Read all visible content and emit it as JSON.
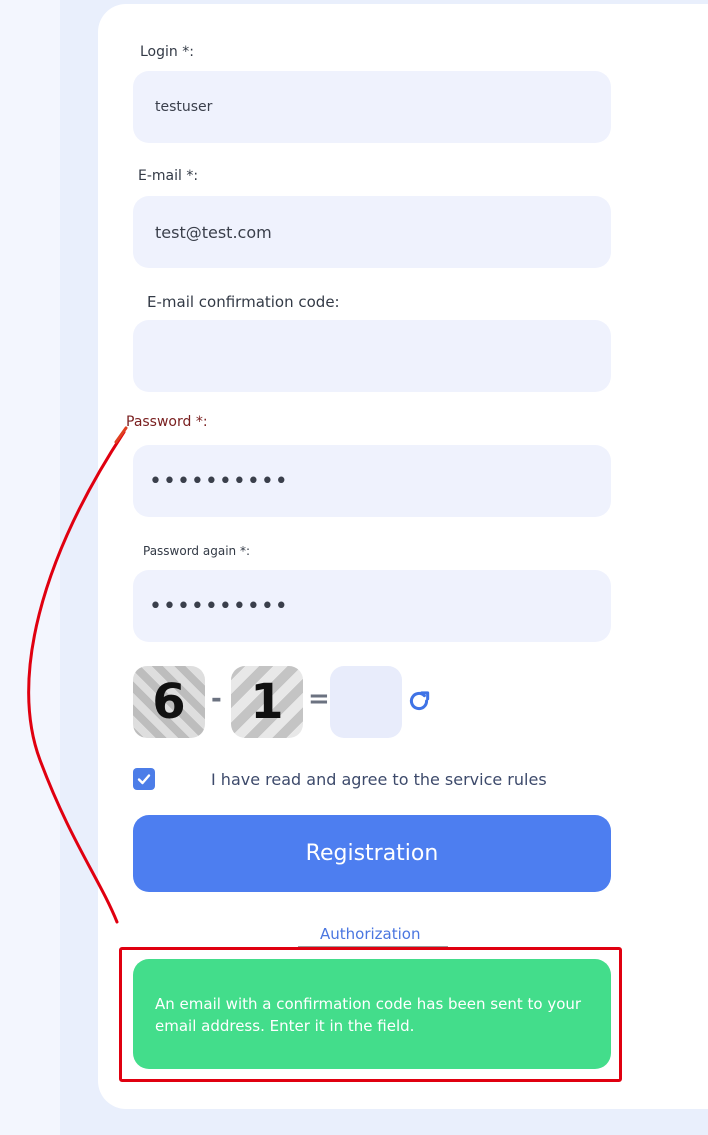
{
  "form": {
    "login": {
      "label": "Login *:",
      "value": "testuser"
    },
    "email": {
      "label": "E-mail *:",
      "value": "test@test.com"
    },
    "email_code": {
      "label": "E-mail confirmation code:",
      "value": ""
    },
    "password": {
      "label": "Password *:",
      "value": "••••••••••"
    },
    "password_again": {
      "label": "Password again *:",
      "value": "••••••••••"
    }
  },
  "captcha": {
    "first": "6",
    "operator": "-",
    "second": "1",
    "equals": "=",
    "answer": "",
    "refresh_icon": "refresh-icon"
  },
  "agreement": {
    "checked": true,
    "text": "I have read and agree to the service rules"
  },
  "registration_button": "Registration",
  "authorization_link": "Authorization",
  "notification": "An email with a confirmation code has been sent to your email address. Enter it in the field.",
  "colors": {
    "accent": "#4d7ef0",
    "notice": "#43dd8b",
    "annotation": "#e00010",
    "field_bg": "#eff2fd"
  }
}
